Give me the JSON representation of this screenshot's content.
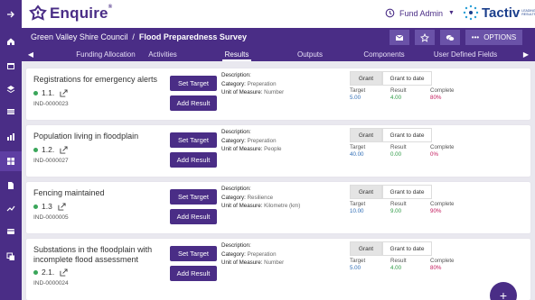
{
  "header": {
    "logo_text": "Enquire",
    "logo_reg": "®",
    "user_name": "Fund Admin",
    "partner_logo_text": "Tactiv",
    "partner_logo_sub": "LEADING RESULTS",
    "breadcrumb_org": "Green Valley Shire Council",
    "breadcrumb_sep": "/",
    "breadcrumb_project": "Flood Preparedness Survey",
    "options_label": "OPTIONS"
  },
  "tabs": [
    {
      "label": "Funding Allocation"
    },
    {
      "label": "Activities"
    },
    {
      "label": "Results"
    },
    {
      "label": "Outputs"
    },
    {
      "label": "Components"
    },
    {
      "label": "User Defined Fields"
    }
  ],
  "labels": {
    "set_target": "Set Target",
    "add_result": "Add Result",
    "description": "Description:",
    "category": "Category:",
    "unit": "Unit of Measure:",
    "grant": "Grant",
    "grant_to_date": "Grant to date",
    "target": "Target",
    "result": "Result",
    "complete": "Complete"
  },
  "indicators": [
    {
      "name": "Registrations for emergency alerts",
      "number": "1.1.",
      "code": "IND-0000023",
      "category": "Preperation",
      "unit": "Number",
      "target": "5.00",
      "result": "4.00",
      "complete": "80%"
    },
    {
      "name": "Population living in floodplain",
      "number": "1.2.",
      "code": "IND-0000027",
      "category": "Preperation",
      "unit": "People",
      "target": "40.00",
      "result": "0.00",
      "complete": "0%"
    },
    {
      "name": "Fencing maintained",
      "number": "1.3",
      "code": "IND-0000005",
      "category": "Resilience",
      "unit": "Kilometre (km)",
      "target": "10.00",
      "result": "9.00",
      "complete": "90%"
    },
    {
      "name": "Substations in the floodplain with incomplete flood assessment",
      "number": "2.1.",
      "code": "IND-0000024",
      "category": "Preperation",
      "unit": "Number",
      "target": "5.00",
      "result": "4.00",
      "complete": "80%"
    }
  ],
  "fab_label": "+",
  "colors": {
    "brand": "#4a2d86",
    "target": "#2f6db5",
    "result": "#2d9a45",
    "complete": "#c2185b",
    "status_dot": "#3aa65a"
  },
  "icons": [
    "expand-arrow-icon",
    "home-icon",
    "calendar-icon",
    "layers-icon",
    "table-icon",
    "grid-icon",
    "document-icon",
    "trend-icon",
    "card-icon",
    "copy-icon",
    "history-icon",
    "mail-icon",
    "star-icon",
    "chat-icon",
    "edit-icon"
  ]
}
